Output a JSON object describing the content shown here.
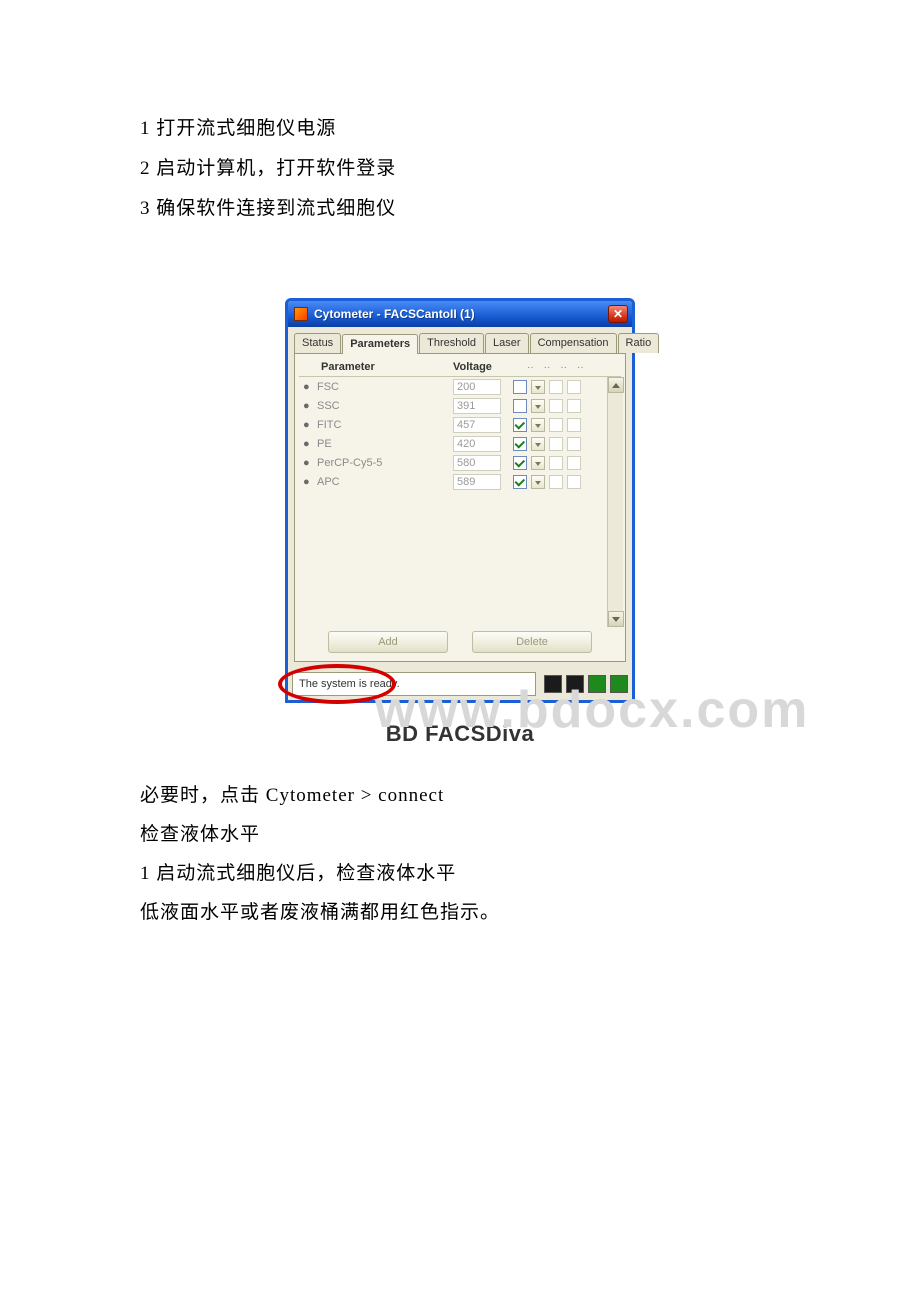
{
  "doc": {
    "p1": "1 打开流式细胞仪电源",
    "p2": "2 启动计算机，打开软件登录",
    "p3": "3 确保软件连接到流式细胞仪",
    "p4_prefix": "必要时，点击 ",
    "p4_en": "Cytometer > connect",
    "p5": "检查液体水平",
    "p6": "1 启动流式细胞仪后，检查液体水平",
    "p7": "低液面水平或者废液桶满都用红色指示。"
  },
  "window": {
    "title": "Cytometer - FACSCantoII (1)",
    "close_glyph": "✕",
    "tabs": [
      "Status",
      "Parameters",
      "Threshold",
      "Laser",
      "Compensation",
      "Ratio"
    ],
    "active_tab_index": 1,
    "headers": {
      "parameter": "Parameter",
      "voltage": "Voltage"
    },
    "header_dots": [
      "··",
      "··",
      "··",
      "··"
    ],
    "rows": [
      {
        "name": "FSC",
        "voltage": "200",
        "checked": false
      },
      {
        "name": "SSC",
        "voltage": "391",
        "checked": false
      },
      {
        "name": "FITC",
        "voltage": "457",
        "checked": true
      },
      {
        "name": "PE",
        "voltage": "420",
        "checked": true
      },
      {
        "name": "PerCP-Cy5-5",
        "voltage": "580",
        "checked": true
      },
      {
        "name": "APC",
        "voltage": "589",
        "checked": true
      }
    ],
    "buttons": {
      "add": "Add",
      "delete": "Delete"
    },
    "status_text": "The system is ready.",
    "software_title": "BD FACSDiva",
    "watermark": "www.bdocx.com"
  }
}
